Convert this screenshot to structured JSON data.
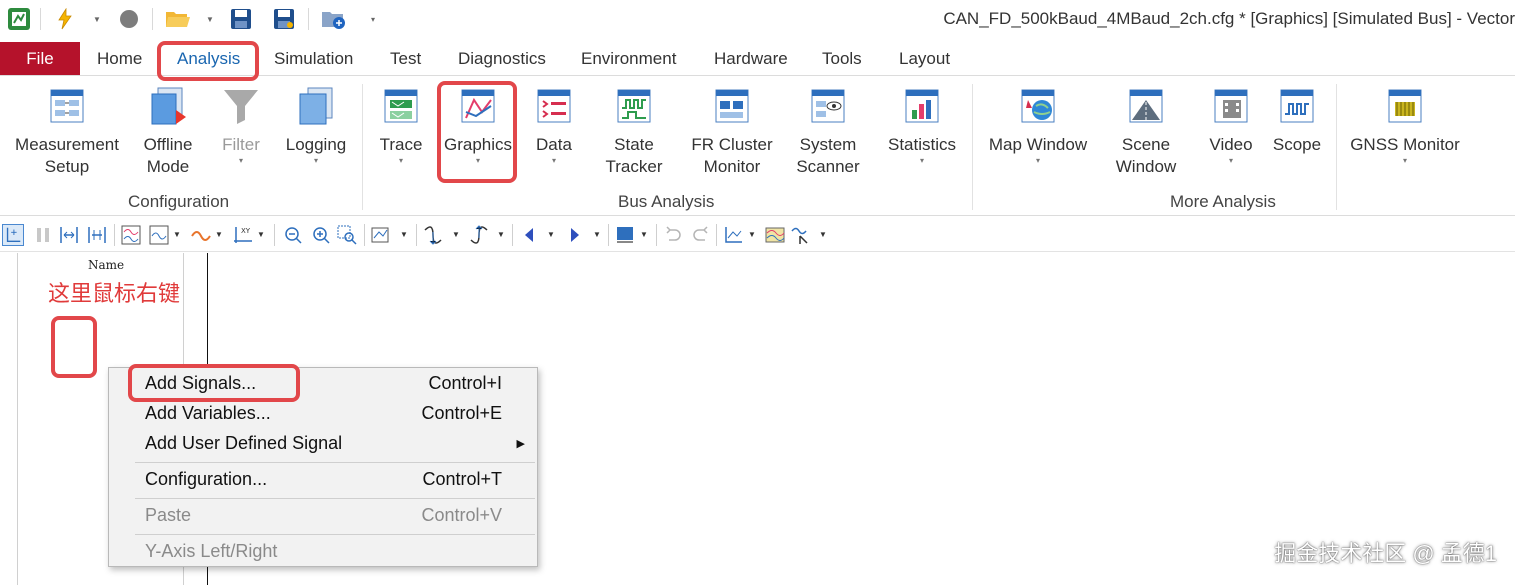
{
  "window": {
    "title": "CAN_FD_500kBaud_4MBaud_2ch.cfg * [Graphics] [Simulated Bus] - Vector"
  },
  "quick_access": [
    "app-icon",
    "lightning-icon",
    "stop-icon",
    "open-folder-icon",
    "save-icon",
    "save-as-icon",
    "config-folder-icon"
  ],
  "menu": {
    "file": "File",
    "tabs": [
      "Home",
      "Analysis",
      "Simulation",
      "Test",
      "Diagnostics",
      "Environment",
      "Hardware",
      "Tools",
      "Layout"
    ],
    "active_tab": "Analysis"
  },
  "ribbon": {
    "groups": {
      "configuration": "Configuration",
      "bus_analysis": "Bus Analysis",
      "more_analysis": "More Analysis"
    },
    "buttons": {
      "measurement_setup": [
        "Measurement",
        "Setup"
      ],
      "offline_mode": [
        "Offline",
        "Mode"
      ],
      "filter": "Filter",
      "logging": "Logging",
      "trace": "Trace",
      "graphics": "Graphics",
      "data": "Data",
      "state_tracker": [
        "State",
        "Tracker"
      ],
      "fr_cluster_monitor": [
        "FR Cluster",
        "Monitor"
      ],
      "system_scanner": [
        "System",
        "Scanner"
      ],
      "statistics": "Statistics",
      "map_window": "Map Window",
      "scene_window": [
        "Scene",
        "Window"
      ],
      "video": "Video",
      "scope": "Scope",
      "gnss_monitor": "GNSS Monitor"
    }
  },
  "graphics_panel": {
    "column_header": "Name",
    "annotation": "这里鼠标右键"
  },
  "context_menu": {
    "items": [
      {
        "label": "Add Signals...",
        "shortcut": "Control+I",
        "enabled": true
      },
      {
        "label": "Add Variables...",
        "shortcut": "Control+E",
        "enabled": true
      },
      {
        "label": "Add User Defined Signal",
        "shortcut": "",
        "enabled": true,
        "submenu": true
      },
      {
        "label": "Configuration...",
        "shortcut": "Control+T",
        "enabled": true
      },
      {
        "label": "Paste",
        "shortcut": "Control+V",
        "enabled": false
      },
      {
        "label": "Y-Axis Left/Right",
        "shortcut": "",
        "enabled": false
      }
    ]
  },
  "watermark": "掘金技术社区 @ 孟德1",
  "colors": {
    "file_tab": "#b5122b",
    "active_tab_text": "#1a66b0",
    "annotation": "#e2474a",
    "menu_background": "#f2f2f2"
  }
}
